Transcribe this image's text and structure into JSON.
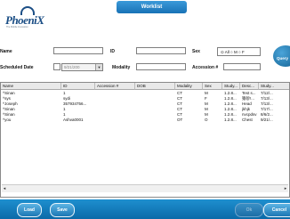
{
  "header": {
    "logo_text": "PhoeniX",
    "logo_subtitle": "The Mobile Innovation",
    "title": "Worklist"
  },
  "filters": {
    "name_label": "Name",
    "name_value": "",
    "id_label": "ID",
    "id_value": "",
    "sex_label": "Sex",
    "sex_options": "⊙ All ○ M ○ F",
    "scheduled_date_label": "Scheduled Date",
    "scheduled_date_value": "9/21/200",
    "modality_label": "Modality",
    "modality_value": "",
    "accession_label": "Accession #",
    "accession_value": "",
    "query_label": "Query"
  },
  "table": {
    "columns": [
      "Name",
      "ID",
      "Accession #",
      "DOB",
      "Modality",
      "Sex",
      "Study...",
      "Desc...",
      "Study..."
    ],
    "rows": [
      [
        "^Sinan",
        "1",
        "",
        "",
        "CT",
        "M",
        "1.2.8...",
        "Test s...",
        "7/12/..."
      ],
      [
        "^sys",
        "sydi",
        "",
        "",
        "CT",
        "F",
        "1.2.8...",
        "猿砂ǃ...",
        "7/13/..."
      ],
      [
        "^Joseph",
        "357934756...",
        "",
        "",
        "CT",
        "M",
        "1.2.8...",
        "Head",
        "7/13/..."
      ],
      [
        "^Sinan",
        "1",
        "",
        "",
        "CT",
        "M",
        "1.2.8...",
        "jkhjk",
        "7/17/..."
      ],
      [
        "^Sinan",
        "1",
        "",
        "",
        "CT",
        "M",
        "1.2.8...",
        "nvcpdsv",
        "8/6/2..."
      ],
      [
        "^you",
        "Ashva0001",
        "",
        "",
        "OT",
        "O",
        "1.2.8...",
        "Chest",
        "9/21/..."
      ]
    ]
  },
  "footer": {
    "load_label": "Load",
    "save_label": "Save",
    "ok_label": "Ok",
    "cancel_label": "Cancel"
  }
}
